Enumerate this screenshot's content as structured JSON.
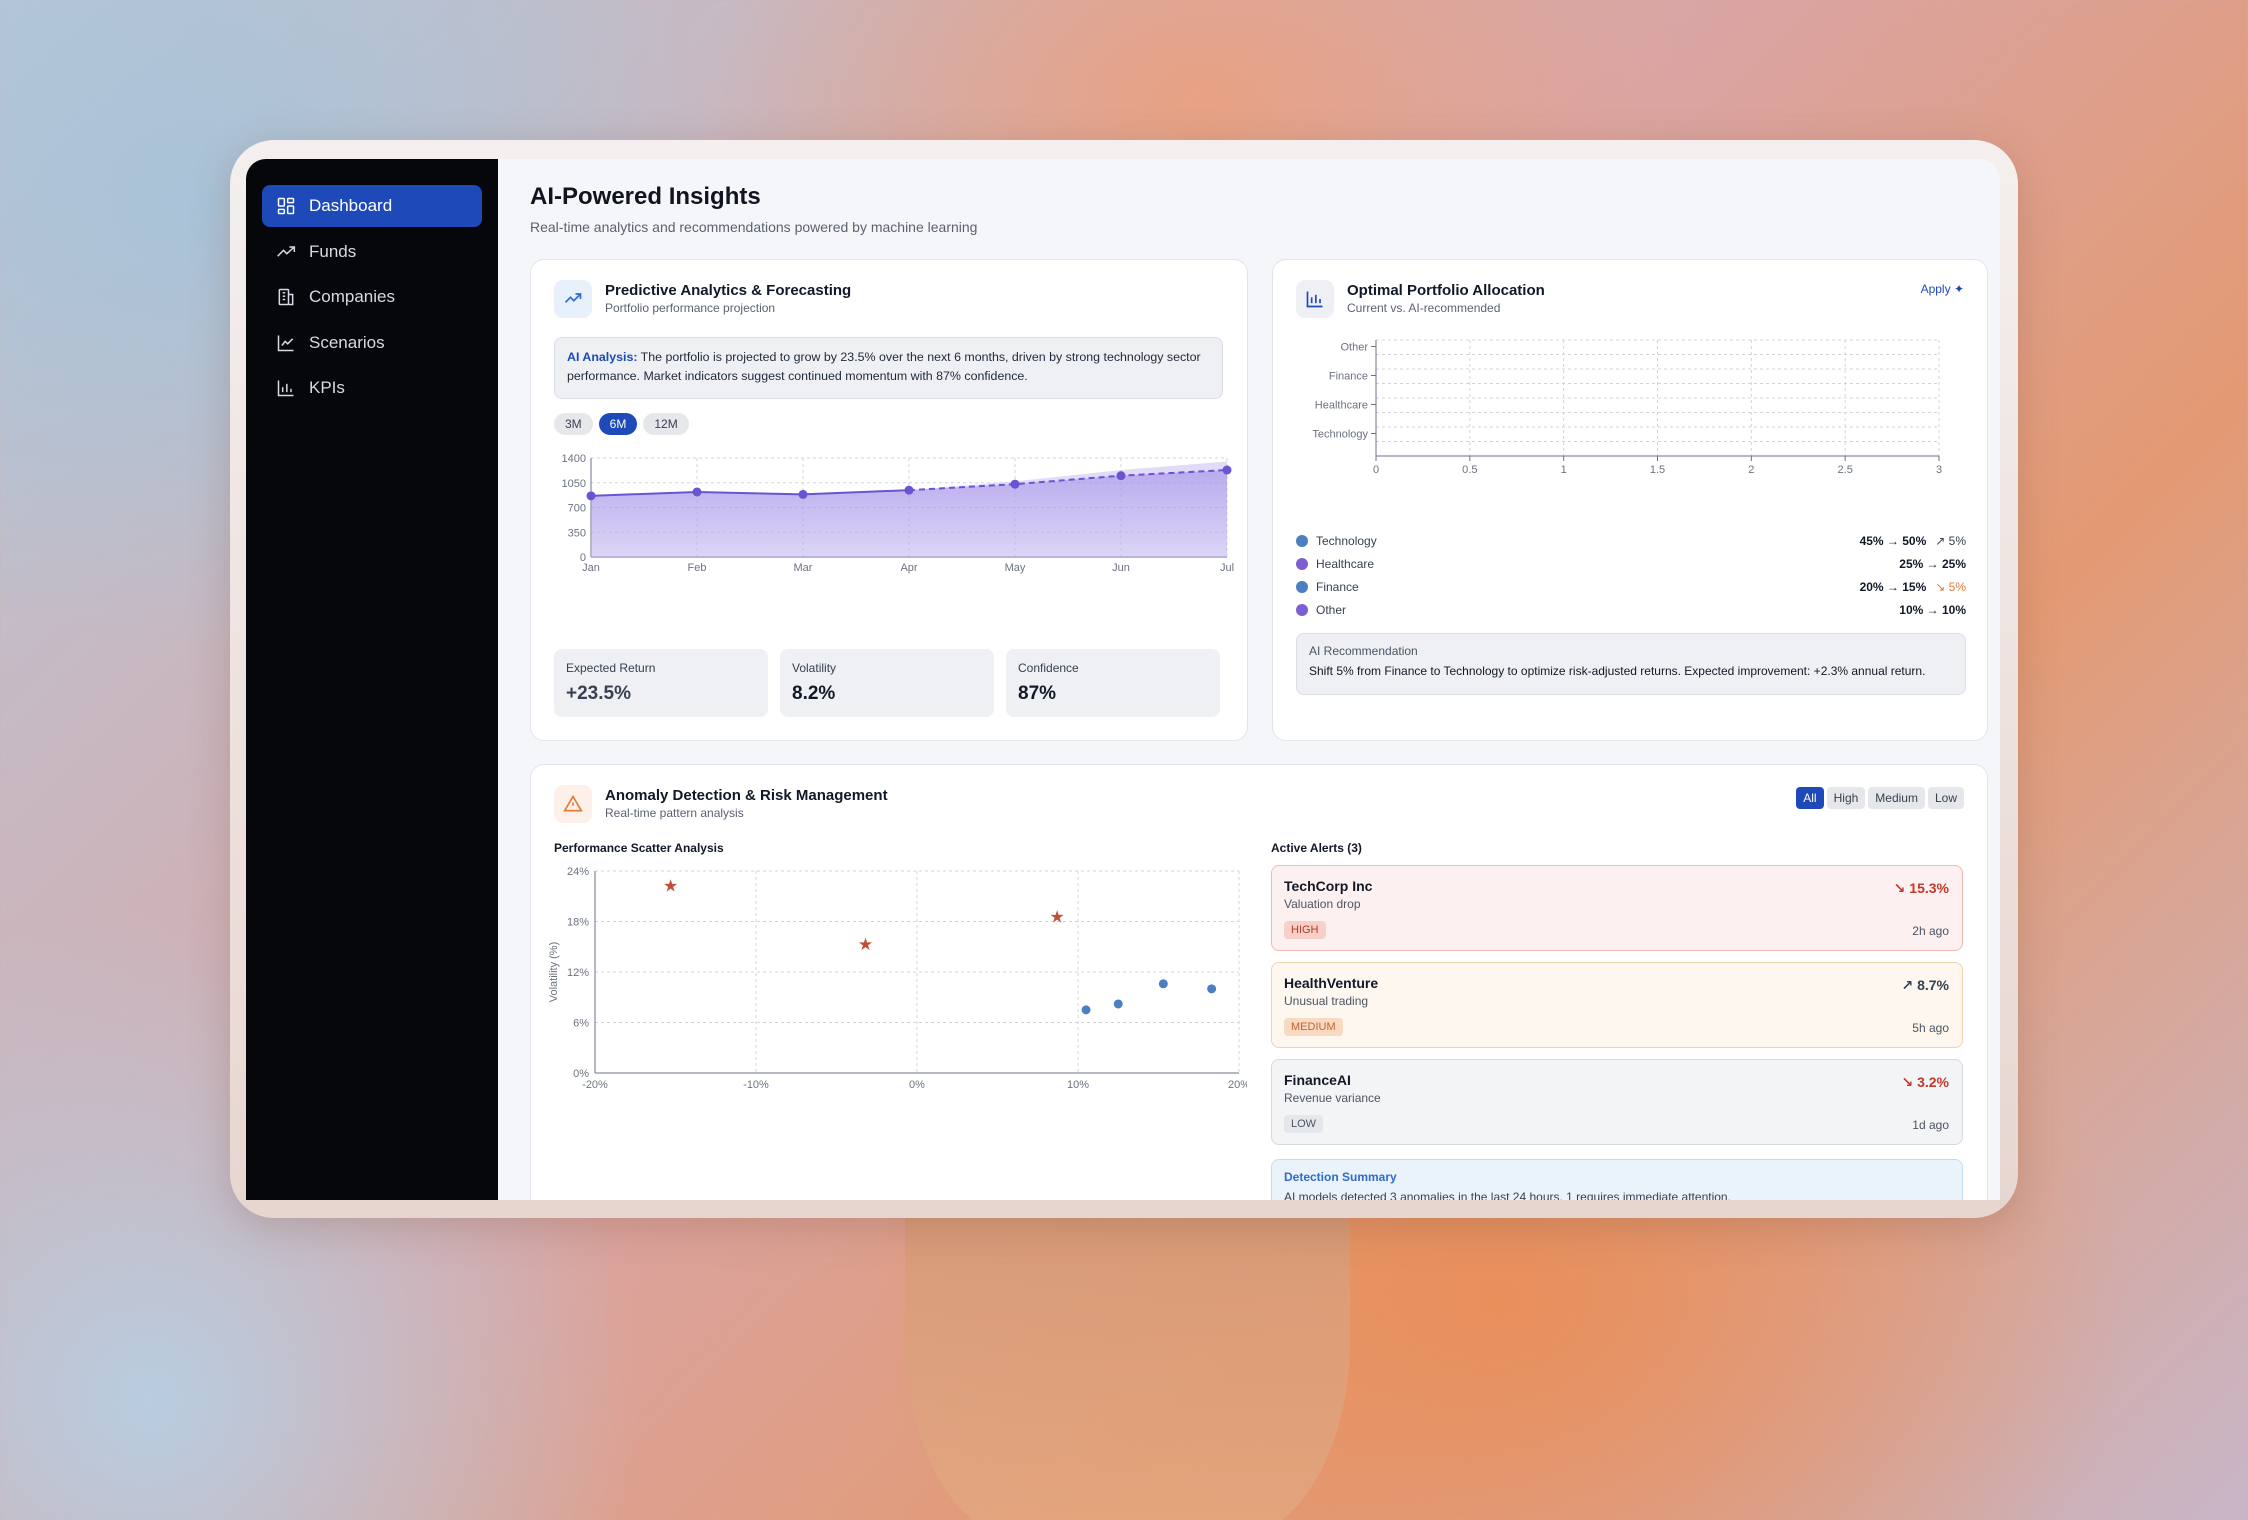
{
  "sidebar": {
    "items": [
      {
        "label": "Dashboard",
        "icon": "dashboard-icon",
        "active": true
      },
      {
        "label": "Funds",
        "icon": "trend-up-icon",
        "active": false
      },
      {
        "label": "Companies",
        "icon": "building-icon",
        "active": false
      },
      {
        "label": "Scenarios",
        "icon": "line-chart-icon",
        "active": false
      },
      {
        "label": "KPIs",
        "icon": "bar-chart-icon",
        "active": false
      }
    ]
  },
  "header": {
    "title": "AI-Powered Insights",
    "subtitle": "Real-time analytics and recommendations powered by machine learning"
  },
  "predictive": {
    "title": "Predictive Analytics & Forecasting",
    "subtitle": "Portfolio performance projection",
    "ai_label": "AI Analysis:",
    "ai_text": " The portfolio is projected to grow by 23.5% over the next 6 months, driven by strong technology sector performance. Market indicators suggest continued momentum with 87% confidence.",
    "ranges": [
      "3M",
      "6M",
      "12M"
    ],
    "active_range": "6M",
    "stats": [
      {
        "label": "Expected Return",
        "value": "+23.5%"
      },
      {
        "label": "Volatility",
        "value": "8.2%"
      },
      {
        "label": "Confidence",
        "value": "87%"
      }
    ]
  },
  "allocation": {
    "title": "Optimal Portfolio Allocation",
    "subtitle": "Current vs. AI-recommended",
    "apply_label": "Apply",
    "rows": [
      {
        "name": "Technology",
        "value": "45% → 50%",
        "change": "↗ 5%",
        "color": "#4a7fc1",
        "change_color": "#374151"
      },
      {
        "name": "Healthcare",
        "value": "25% → 25%",
        "change": "",
        "color": "#7b5fd3",
        "change_color": "#374151"
      },
      {
        "name": "Finance",
        "value": "20% → 15%",
        "change": "↘ 5%",
        "color": "#4a7fc1",
        "change_color": "#e07b39"
      },
      {
        "name": "Other",
        "value": "10% → 10%",
        "change": "",
        "color": "#7b5fd3",
        "change_color": "#374151"
      }
    ],
    "recommendation_label": "AI Recommendation",
    "recommendation_text": "Shift 5% from Finance to Technology to optimize risk-adjusted returns. Expected improvement: +2.3% annual return."
  },
  "anomaly": {
    "title": "Anomaly Detection & Risk Management",
    "subtitle": "Real-time pattern analysis",
    "filters": [
      "All",
      "High",
      "Medium",
      "Low"
    ],
    "active_filter": "All",
    "scatter_title": "Performance Scatter Analysis",
    "scatter_ylabel": "Volatility (%)",
    "alerts_title": "Active Alerts (3)",
    "alerts": [
      {
        "name": "TechCorp Inc",
        "desc": "Valuation drop",
        "badge": "HIGH",
        "change": "↘ 15.3%",
        "time": "2h ago"
      },
      {
        "name": "HealthVenture",
        "desc": "Unusual trading",
        "badge": "MEDIUM",
        "change": "↗ 8.7%",
        "time": "5h ago"
      },
      {
        "name": "FinanceAI",
        "desc": "Revenue variance",
        "badge": "LOW",
        "change": "↘ 3.2%",
        "time": "1d ago"
      }
    ],
    "summary_title": "Detection Summary",
    "summary_text": "AI models detected 3 anomalies in the last 24 hours. 1 requires immediate attention."
  },
  "colors": {
    "accent": "#1d4ab8",
    "purple": "#7b5fd3",
    "blue_point": "#4a7fc1",
    "anomaly_star": "#c0503a"
  },
  "chart_data": [
    {
      "type": "area",
      "categories": [
        "Jan",
        "Feb",
        "Mar",
        "Apr",
        "May",
        "Jun",
        "Jul"
      ],
      "series": [
        {
          "values": [
            865,
            920,
            885,
            945,
            1030,
            1150,
            1230
          ]
        }
      ],
      "actual_points": 4,
      "yticks": [
        0,
        350,
        700,
        1050,
        1400
      ],
      "ylim": [
        0,
        1400
      ],
      "grid": true
    },
    {
      "type": "bar",
      "orientation": "horizontal",
      "categories": [
        "Technology",
        "Healthcare",
        "Finance",
        "Other"
      ],
      "values": [
        0,
        0,
        0,
        0
      ],
      "xticks": [
        0,
        0.5,
        1,
        1.5,
        2,
        2.5,
        3
      ],
      "xlim": [
        0,
        3
      ],
      "grid": true
    },
    {
      "type": "scatter",
      "x_ticks": [
        "-20%",
        "-10%",
        "0%",
        "10%",
        "20%"
      ],
      "y_ticks": [
        "0%",
        "6%",
        "12%",
        "18%",
        "24%"
      ],
      "xlim": [
        -20,
        20
      ],
      "ylim": [
        0,
        24
      ],
      "ylabel": "Volatility (%)",
      "series": [
        {
          "marker": "star",
          "points": [
            [
              -15.3,
              22.3
            ],
            [
              -3.2,
              15.3
            ],
            [
              8.7,
              18.6
            ]
          ]
        },
        {
          "marker": "circle",
          "points": [
            [
              10.5,
              7.5
            ],
            [
              12.5,
              8.2
            ],
            [
              15.3,
              10.6
            ],
            [
              18.3,
              10.0
            ]
          ]
        }
      ],
      "grid": true
    }
  ]
}
